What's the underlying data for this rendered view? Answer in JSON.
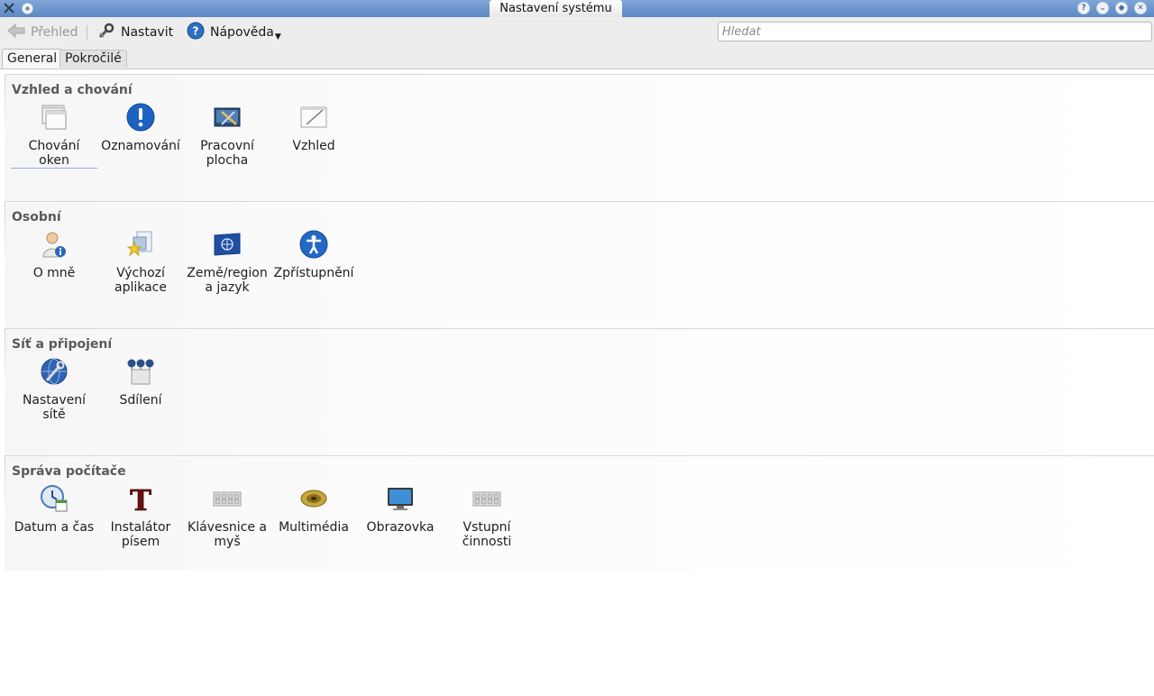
{
  "window": {
    "title": "Nastavení systému"
  },
  "toolbar": {
    "back_label": "Přehled",
    "configure_label": "Nastavit",
    "help_label": "Nápověda",
    "search_placeholder": "Hledat"
  },
  "tabs": [
    {
      "label": "General",
      "active": true
    },
    {
      "label": "Pokročilé",
      "active": false
    }
  ],
  "sections": [
    {
      "title": "Vzhled a chování",
      "items": [
        {
          "label": "Chování oken",
          "icon": "window-behavior-icon"
        },
        {
          "label": "Oznamování",
          "icon": "notifications-icon"
        },
        {
          "label": "Pracovní plocha",
          "icon": "desktop-icon"
        },
        {
          "label": "Vzhled",
          "icon": "appearance-icon"
        }
      ]
    },
    {
      "title": "Osobní",
      "items": [
        {
          "label": "O mně",
          "icon": "about-me-icon"
        },
        {
          "label": "Výchozí aplikace",
          "icon": "default-apps-icon"
        },
        {
          "label": "Země/region a jazyk",
          "icon": "locale-flag-icon"
        },
        {
          "label": "Zpřístupnění",
          "icon": "accessibility-icon"
        }
      ]
    },
    {
      "title": "Síť a připojení",
      "items": [
        {
          "label": "Nastavení sítě",
          "icon": "network-settings-icon"
        },
        {
          "label": "Sdílení",
          "icon": "sharing-icon"
        }
      ]
    },
    {
      "title": "Správa počítače",
      "items": [
        {
          "label": "Datum a čas",
          "icon": "clock-icon"
        },
        {
          "label": "Instalátor písem",
          "icon": "font-installer-icon"
        },
        {
          "label": "Klávesnice a myš",
          "icon": "keyboard-icon"
        },
        {
          "label": "Multimédia",
          "icon": "speaker-icon"
        },
        {
          "label": "Obrazovka",
          "icon": "monitor-icon"
        },
        {
          "label": "Vstupní činnosti",
          "icon": "input-actions-icon"
        }
      ]
    }
  ]
}
